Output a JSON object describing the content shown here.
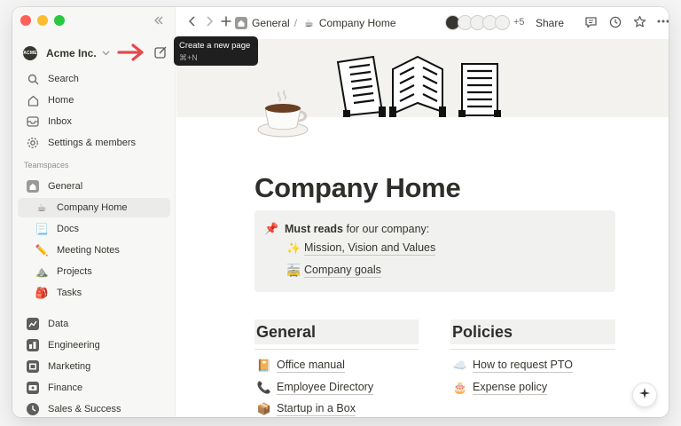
{
  "workspace": {
    "name": "Acme Inc.",
    "logo_text": "ACME"
  },
  "tooltip": {
    "title": "Create a new page",
    "shortcut": "⌘+N"
  },
  "sidebar": {
    "top_items": [
      {
        "label": "Search",
        "icon": "search-icon"
      },
      {
        "label": "Home",
        "icon": "home-icon"
      },
      {
        "label": "Inbox",
        "icon": "inbox-icon"
      },
      {
        "label": "Settings & members",
        "icon": "gear-icon"
      }
    ],
    "section_label": "Teamspaces",
    "teamspace": {
      "label": "General",
      "icon": "house-icon"
    },
    "pages": [
      {
        "label": "Company Home",
        "emoji": "☕",
        "active": true
      },
      {
        "label": "Docs",
        "emoji": "📃"
      },
      {
        "label": "Meeting Notes",
        "emoji": "✏️"
      },
      {
        "label": "Projects",
        "emoji": "⛰️"
      },
      {
        "label": "Tasks",
        "emoji": "🎒"
      }
    ],
    "teamspaces": [
      {
        "label": "Data",
        "icon": "data-icon"
      },
      {
        "label": "Engineering",
        "icon": "engineering-icon"
      },
      {
        "label": "Marketing",
        "icon": "marketing-icon"
      },
      {
        "label": "Finance",
        "icon": "finance-icon"
      },
      {
        "label": "Sales & Success",
        "icon": "sales-icon"
      }
    ]
  },
  "topbar": {
    "breadcrumb": [
      "General",
      "Company Home"
    ],
    "breadcrumb_separator": "/",
    "page_emoji": "☕",
    "extra_viewers": "+5",
    "share_label": "Share"
  },
  "page": {
    "icon": "coffee-cup-icon",
    "title": "Company Home",
    "callout": {
      "emoji": "📌",
      "bold_text": "Must reads",
      "text": " for our company:",
      "links": [
        {
          "emoji": "✨",
          "label": "Mission, Vision and Values"
        },
        {
          "emoji": "🚋",
          "label": "Company goals"
        }
      ]
    },
    "columns": [
      {
        "heading": "General",
        "links": [
          {
            "emoji": "📔",
            "label": "Office manual"
          },
          {
            "emoji": "📞",
            "label": "Employee Directory"
          },
          {
            "emoji": "📦",
            "label": "Startup in a Box"
          }
        ]
      },
      {
        "heading": "Policies",
        "links": [
          {
            "emoji": "☁️",
            "label": "How to request PTO"
          },
          {
            "emoji": "🎂",
            "label": "Expense policy"
          }
        ]
      }
    ]
  }
}
